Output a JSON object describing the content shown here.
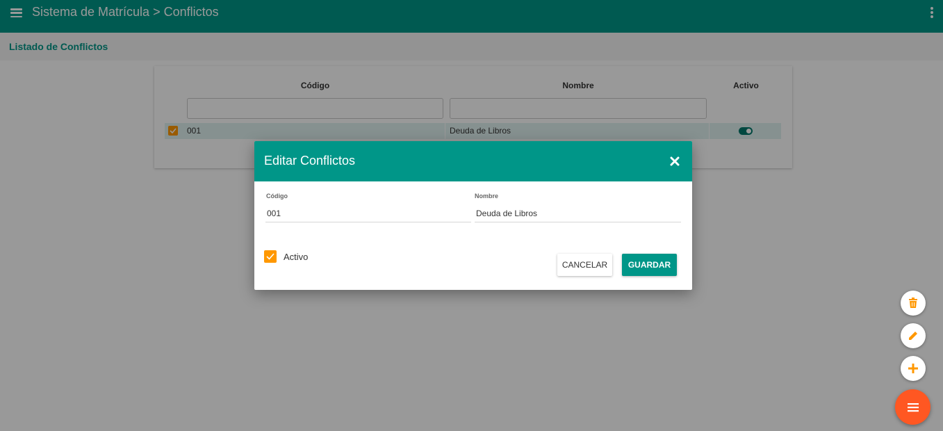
{
  "header": {
    "title": "Sistema de Matrícula > Conflictos",
    "menu_icon": "hamburger-menu-icon",
    "more_icon": "more-vertical-icon",
    "color": "#009688"
  },
  "subheader": {
    "title": "Listado de Conflictos"
  },
  "table": {
    "columns": [
      "Código",
      "Nombre",
      "Activo"
    ],
    "filters": {
      "codigo": "",
      "nombre": ""
    },
    "rows": [
      {
        "selected": true,
        "codigo": "001",
        "nombre": "Deuda de Libros",
        "activo": true
      }
    ]
  },
  "dialog": {
    "title": "Editar Conflictos",
    "close_icon": "close-icon",
    "codigo_label": "Código",
    "codigo_value": "001",
    "nombre_label": "Nombre",
    "nombre_value": "Deuda de Libros",
    "activo_label": "Activo",
    "activo_checked": true,
    "cancel_label": "CANCELAR",
    "save_label": "GUARDAR"
  },
  "fab": {
    "delete_icon": "trash-icon",
    "edit_icon": "pencil-icon",
    "add_icon": "plus-icon",
    "menu_icon": "menu-icon",
    "accent": "#ff9800",
    "main_color": "#ff5722"
  }
}
